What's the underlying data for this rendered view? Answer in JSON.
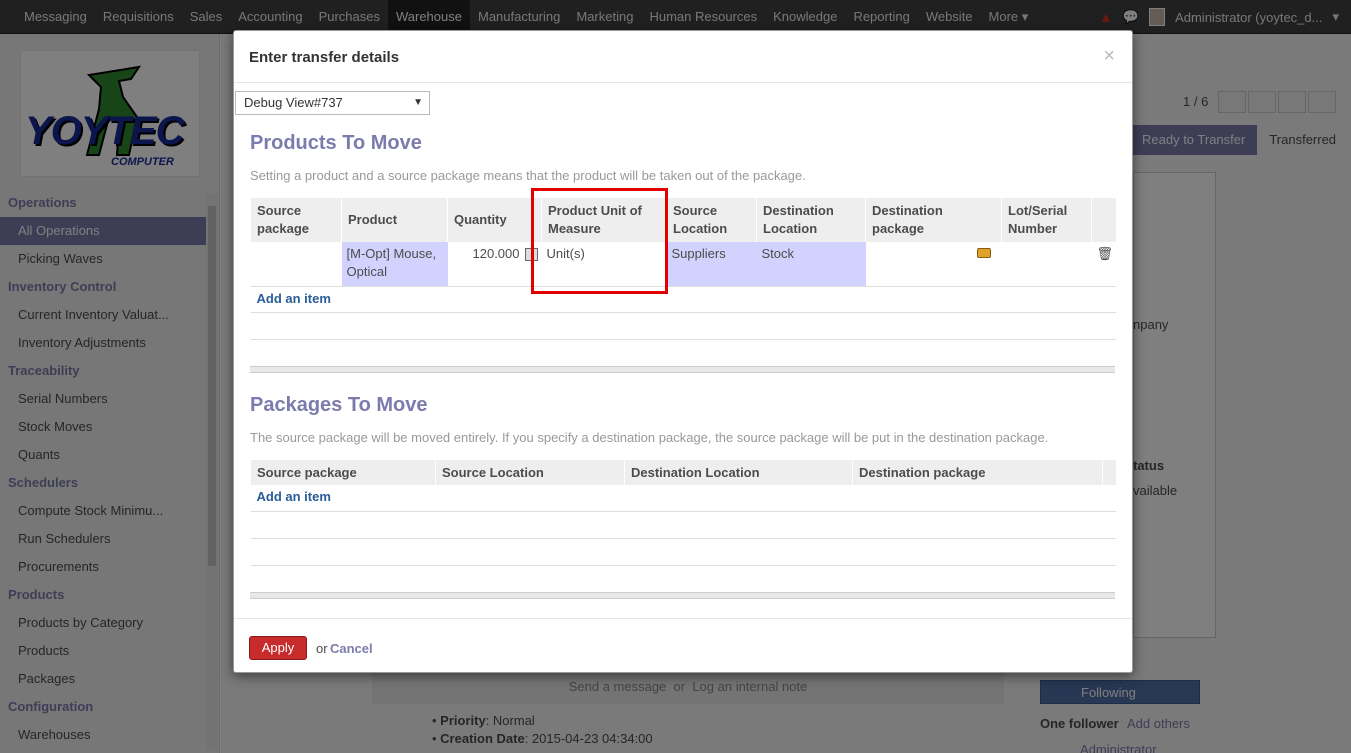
{
  "topbar": {
    "menu": [
      "Messaging",
      "Requisitions",
      "Sales",
      "Accounting",
      "Purchases",
      "Warehouse",
      "Manufacturing",
      "Marketing",
      "Human Resources",
      "Knowledge",
      "Reporting",
      "Website",
      "More"
    ],
    "active": "Warehouse",
    "user": "Administrator (yoytec_d..."
  },
  "logo": {
    "text": "YOYTEC",
    "sub": "COMPUTER"
  },
  "sidebar": {
    "sections": [
      {
        "title": "Operations",
        "items": [
          "All Operations",
          "Picking Waves"
        ]
      },
      {
        "title": "Inventory Control",
        "items": [
          "Current Inventory Valuat...",
          "Inventory Adjustments"
        ]
      },
      {
        "title": "Traceability",
        "items": [
          "Serial Numbers",
          "Stock Moves",
          "Quants"
        ]
      },
      {
        "title": "Schedulers",
        "items": [
          "Compute Stock Minimu...",
          "Run Schedulers",
          "Procurements"
        ]
      },
      {
        "title": "Products",
        "items": [
          "Products by Category",
          "Products",
          "Packages"
        ]
      },
      {
        "title": "Configuration",
        "items": [
          "Warehouses"
        ]
      }
    ],
    "active_item": "All Operations"
  },
  "background": {
    "pager": "1 / 6",
    "states": [
      "Ready to Transfer",
      "Transferred"
    ],
    "company_fragment": "npany",
    "status_header": "tatus",
    "status_value": "vailable",
    "chatter": {
      "send": "Send a message",
      "or": "or",
      "note": "Log an internal note"
    },
    "follow_button": "Following",
    "followers": "One follower",
    "add_others": "Add others",
    "follower_name": "Administrator",
    "message": {
      "priority_label": "Priority",
      "priority_value": ": Normal",
      "date_label": "Creation Date",
      "date_value": ": 2015-04-23 04:34:00"
    }
  },
  "modal": {
    "title": "Enter transfer details",
    "close": "×",
    "debug_select": "Debug View#737",
    "products_section": {
      "title": "Products To Move",
      "help": "Setting a product and a source package means that the product will be taken out of the package.",
      "headers": [
        "Source package",
        "Product",
        "Quantity",
        "Product Unit of Measure",
        "Source Location",
        "Destination Location",
        "Destination package",
        "Lot/Serial Number"
      ],
      "rows": [
        {
          "source_package": "",
          "product": "[M-Opt] Mouse, Optical",
          "quantity": "120.000",
          "uom": "Unit(s)",
          "source_location": "Suppliers",
          "destination_location": "Stock",
          "destination_package": "",
          "lot": ""
        }
      ],
      "add_item": "Add an item"
    },
    "packages_section": {
      "title": "Packages To Move",
      "help": "The source package will be moved entirely. If you specify a destination package, the source package will be put in the destination package.",
      "headers": [
        "Source package",
        "Source Location",
        "Destination Location",
        "Destination package"
      ],
      "add_item": "Add an item"
    },
    "footer": {
      "apply": "Apply",
      "or": "or",
      "cancel": "Cancel"
    }
  },
  "colors": {
    "accent": "#7c7bad",
    "highlight": "#d2d2ff",
    "apply": "#c72b2b",
    "annotation": "#e00000"
  }
}
